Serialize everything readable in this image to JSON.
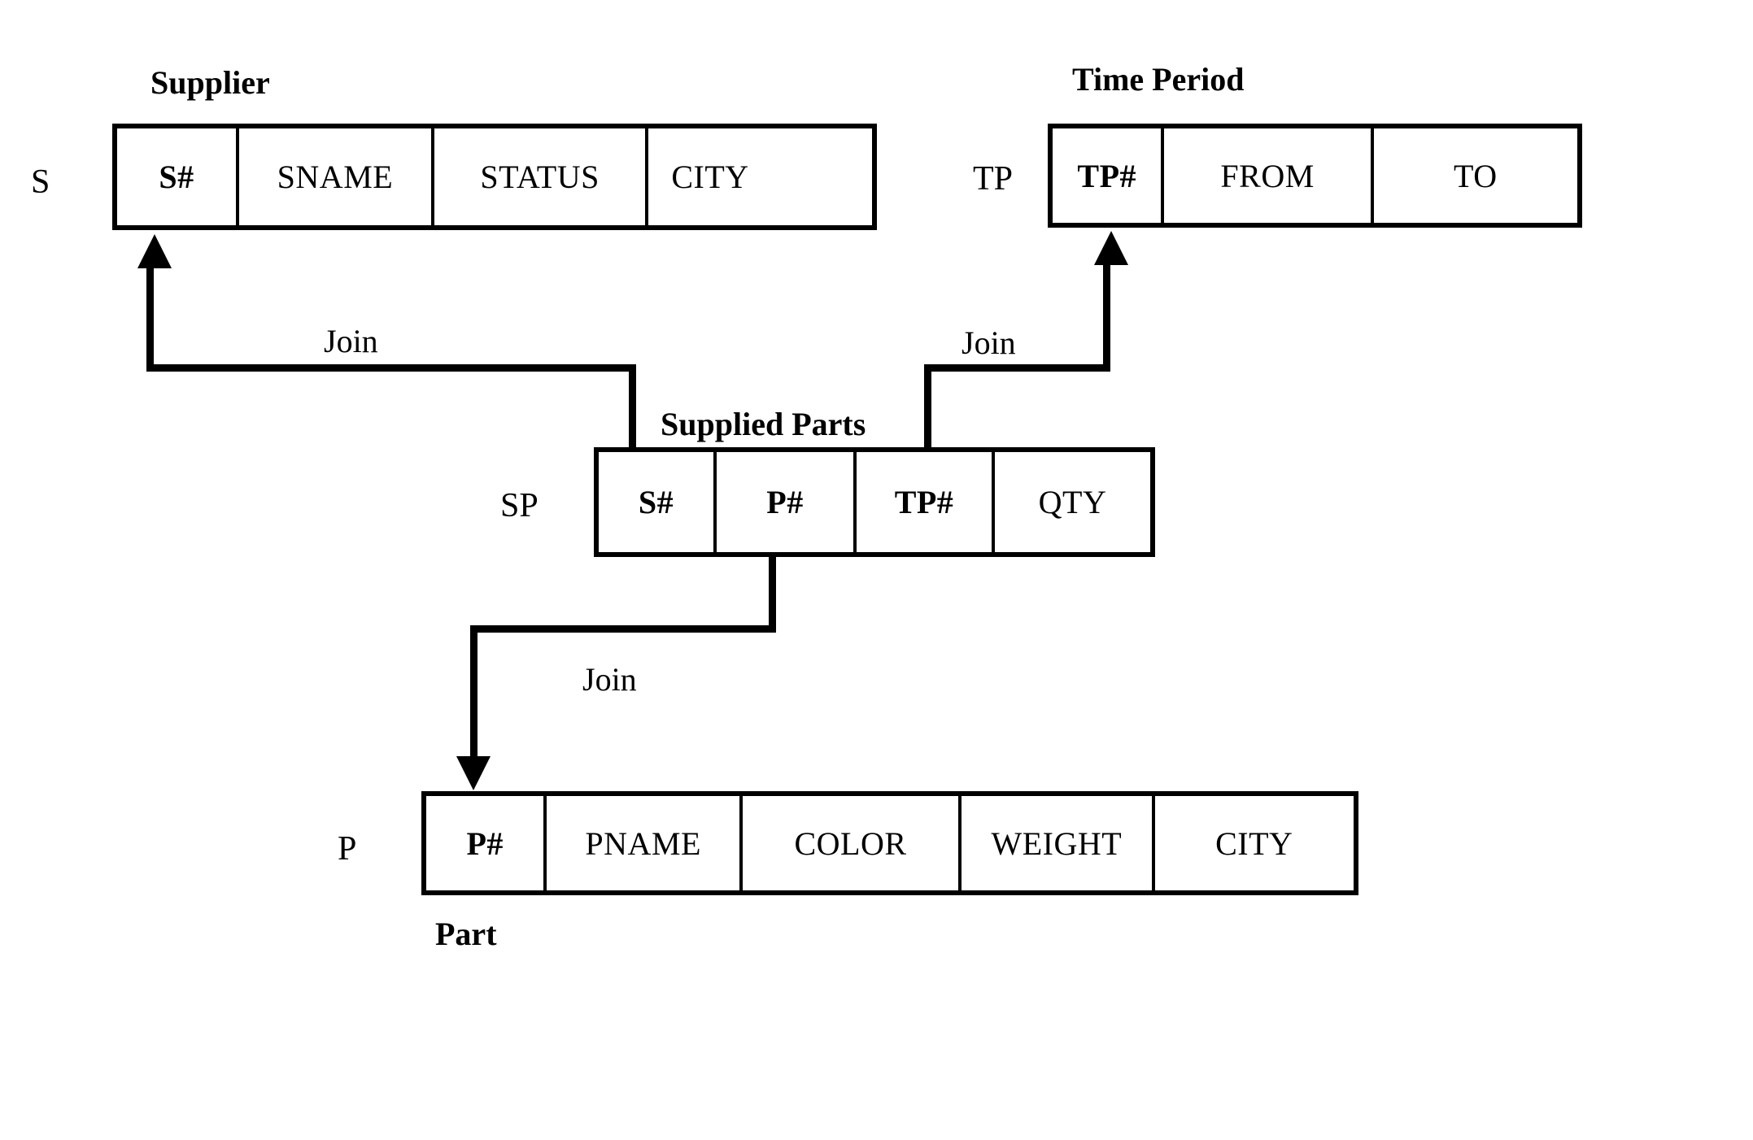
{
  "diagram": {
    "title": "Supplier / Supplied Parts / Part / Time Period relational schema",
    "line_color": "#000000",
    "background_color": "#ffffff"
  },
  "relations": [
    {
      "id": "supplier",
      "abbrev": "S",
      "caption": "Supplier",
      "caption_position": "above",
      "columns": [
        {
          "name": "S#",
          "key": true
        },
        {
          "name": "SNAME",
          "key": false
        },
        {
          "name": "STATUS",
          "key": false
        },
        {
          "name": "CITY",
          "key": false
        }
      ]
    },
    {
      "id": "time_period",
      "abbrev": "TP",
      "caption": "Time Period",
      "caption_position": "above",
      "columns": [
        {
          "name": "TP#",
          "key": true
        },
        {
          "name": "FROM",
          "key": false
        },
        {
          "name": "TO",
          "key": false
        }
      ]
    },
    {
      "id": "supplied_parts",
      "abbrev": "SP",
      "caption": "Supplied Parts",
      "caption_position": "above",
      "columns": [
        {
          "name": "S#",
          "key": true
        },
        {
          "name": "P#",
          "key": true
        },
        {
          "name": "TP#",
          "key": true
        },
        {
          "name": "QTY",
          "key": false
        }
      ]
    },
    {
      "id": "part",
      "abbrev": "P",
      "caption": "Part",
      "caption_position": "below",
      "columns": [
        {
          "name": "P#",
          "key": true
        },
        {
          "name": "PNAME",
          "key": false
        },
        {
          "name": "COLOR",
          "key": false
        },
        {
          "name": "WEIGHT",
          "key": false
        },
        {
          "name": "CITY",
          "key": false
        }
      ]
    }
  ],
  "joins": [
    {
      "id": "sp-to-s",
      "label": "Join",
      "from_relation": "supplied_parts",
      "from_column": "S#",
      "to_relation": "supplier",
      "to_column": "S#"
    },
    {
      "id": "sp-to-tp",
      "label": "Join",
      "from_relation": "supplied_parts",
      "from_column": "TP#",
      "to_relation": "time_period",
      "to_column": "TP#"
    },
    {
      "id": "sp-to-p",
      "label": "Join",
      "from_relation": "supplied_parts",
      "from_column": "P#",
      "to_relation": "part",
      "to_column": "P#"
    }
  ]
}
